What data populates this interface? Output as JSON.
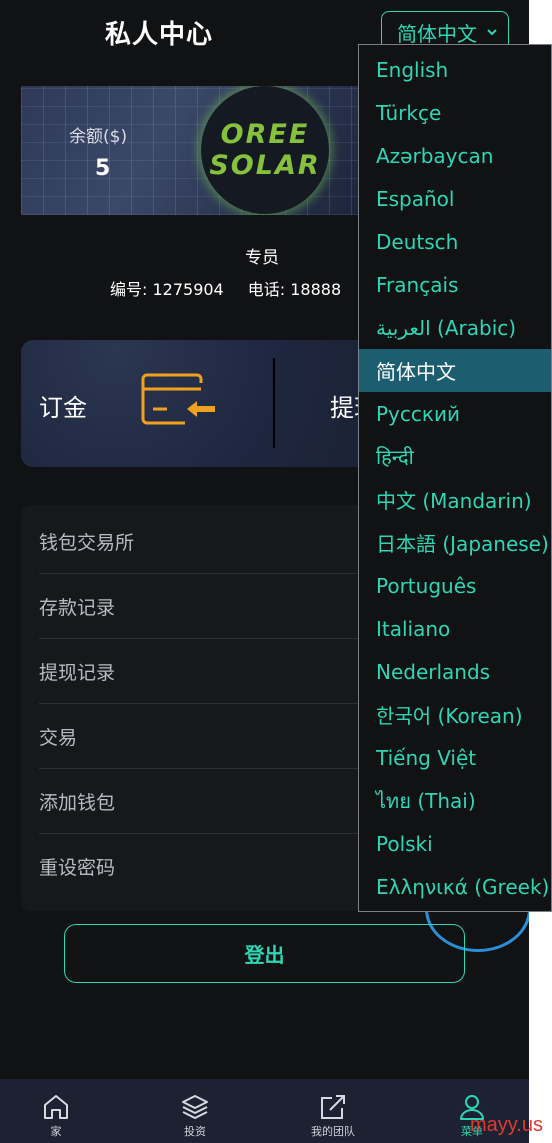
{
  "header": {
    "title": "私人中心",
    "language_selected": "简体中文"
  },
  "banner": {
    "balance_label": "余额($)",
    "balance_value": "5",
    "logo_line1": "OREE",
    "logo_line2": "SOLAR"
  },
  "user": {
    "role": "专员",
    "id_text": "编号: 1275904",
    "phone_text": "电话: 18888"
  },
  "actions": {
    "deposit_label": "订金",
    "withdraw_label": "提现"
  },
  "menu": {
    "items": [
      {
        "label": "钱包交易所"
      },
      {
        "label": "存款记录"
      },
      {
        "label": "提现记录"
      },
      {
        "label": "交易"
      },
      {
        "label": "添加钱包"
      },
      {
        "label": "重设密码"
      }
    ]
  },
  "logout_label": "登出",
  "nav": {
    "items": [
      {
        "label": "家",
        "icon": "home-icon"
      },
      {
        "label": "投资",
        "icon": "layers-icon"
      },
      {
        "label": "我的团队",
        "icon": "share-icon"
      },
      {
        "label": "菜单",
        "icon": "user-icon"
      }
    ]
  },
  "language_dropdown": {
    "options": [
      "English",
      "Türkçe",
      "Azərbaycan",
      "Español",
      "Deutsch",
      "Français",
      "العربية (Arabic)",
      "简体中文",
      "Русский",
      "हिन्दी",
      "中文 (Mandarin)",
      "日本語 (Japanese)",
      "Português",
      "Italiano",
      "Nederlands",
      "한국어 (Korean)",
      "Tiếng Việt",
      "ไทย (Thai)",
      "Polski",
      "Ελληνικά (Greek)"
    ],
    "selected_index": 7
  },
  "watermark": "mayy.us",
  "colors": {
    "accent": "#2fd6b4",
    "background": "#111214",
    "card": "#1f2740",
    "orange": "#f0a21f"
  }
}
